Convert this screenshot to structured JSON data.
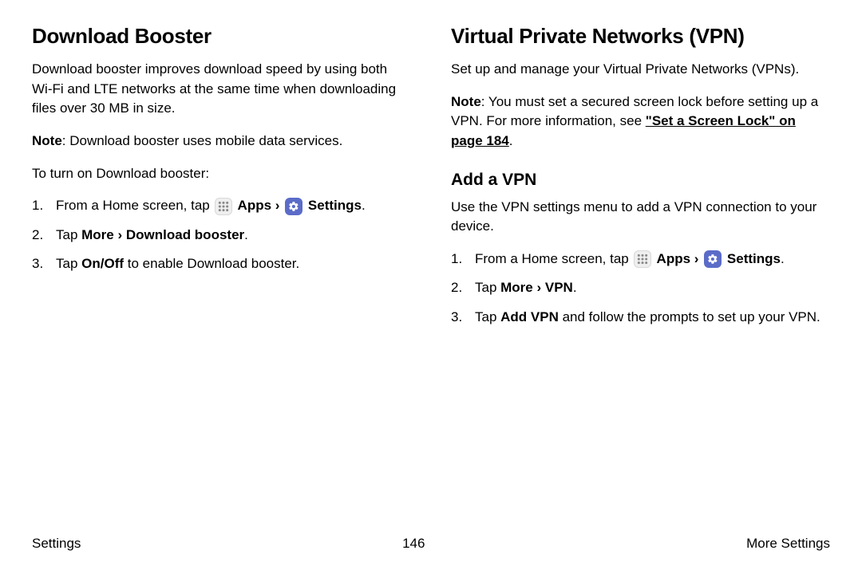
{
  "col_left": {
    "heading": "Download Booster",
    "intro": "Download booster improves download speed by using both Wi-Fi and LTE networks at the same time when downloading files over 30 MB in size.",
    "note_prefix": "Note",
    "note_body": ": Download booster uses mobile data services.",
    "lead_in": "To turn on Download booster:",
    "step1_a": "From a Home screen, tap ",
    "step1_apps": " Apps",
    "step1_sep": " › ",
    "step1_settings": " Settings",
    "step1_dot": ".",
    "step2_a": "Tap ",
    "step2_b": "More › Download booster",
    "step2_dot": ".",
    "step3_a": "Tap ",
    "step3_b": "On/Off",
    "step3_c": " to enable Download booster."
  },
  "col_right": {
    "heading": "Virtual Private Networks (VPN)",
    "intro": "Set up and manage your Virtual Private Networks (VPNs).",
    "note_prefix": "Note",
    "note_body": ": You must set a secured screen lock before setting up a VPN. For more information, see ",
    "note_link": "\"Set a Screen Lock\" on page 184",
    "note_dot": ".",
    "sub_heading": "Add a VPN",
    "sub_intro": "Use the VPN settings menu to add a VPN connection to your device.",
    "step1_a": "From a Home screen, tap ",
    "step1_apps": " Apps",
    "step1_sep": " › ",
    "step1_settings": " Settings",
    "step1_dot": ".",
    "step2_a": "Tap ",
    "step2_b": "More › VPN",
    "step2_dot": ".",
    "step3_a": "Tap ",
    "step3_b": "Add VPN",
    "step3_c": " and follow the prompts to set up your VPN."
  },
  "footer": {
    "left": "Settings",
    "center": "146",
    "right": "More Settings"
  }
}
